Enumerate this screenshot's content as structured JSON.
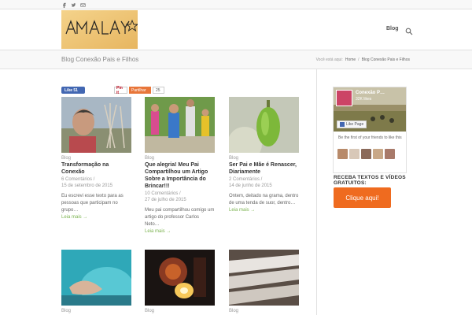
{
  "topbar": {
    "social": [
      "facebook-icon",
      "twitter-icon",
      "mail-icon"
    ]
  },
  "header": {
    "logo_text": "AMALAY☆",
    "nav": {
      "blog": "Blog"
    }
  },
  "titlebar": {
    "title": "Blog Conexão Pais e Filhos",
    "breadcrumb": {
      "prefix": "Você está aqui:",
      "home": "Home",
      "sep": "/",
      "current": "Blog Conexão Pais e Filhos"
    }
  },
  "share": {
    "fb_like": "Like 51",
    "pin": "Pin it",
    "pinterest": "Partilhar",
    "count": "25"
  },
  "posts": [
    {
      "category": "Blog",
      "title": "Transformação na Conexão",
      "comments": "6 Comentários /",
      "date": "15 de setembro de 2015",
      "excerpt": "Eu escrevi esse texto para as pessoas que participam no grupo…",
      "more": "Leia mais →"
    },
    {
      "category": "Blog",
      "title": "Que alegria! Meu Pai Compartilhou um Artigo Sobre a Importância do Brincar!!!",
      "comments": "10 Comentários /",
      "date": "27 de julho de 2015",
      "excerpt": "Meu pai compartilhou comigo um artigo do professor Carlos Neto…",
      "more": "Leia mais →"
    },
    {
      "category": "Blog",
      "title": "Ser Pai e Mãe é Renascer, Diariamente",
      "comments": "2 Comentários /",
      "date": "14 de junho de 2015",
      "excerpt": "Ontem, deitado na grama, dentro de uma tenda de suor, dentro…",
      "more": "Leia mais →"
    },
    {
      "category": "Blog"
    },
    {
      "category": "Blog"
    },
    {
      "category": "Blog"
    }
  ],
  "sidebar": {
    "fb": {
      "name": "Conexão P…",
      "likes": "32K likes",
      "like_page": "Like Page",
      "first": "Be the first of your friends to like this"
    },
    "widget_title": "RECEBA TEXTOS E VÍDEOS GRATUITOS:",
    "cta": "Clique aqui!"
  }
}
